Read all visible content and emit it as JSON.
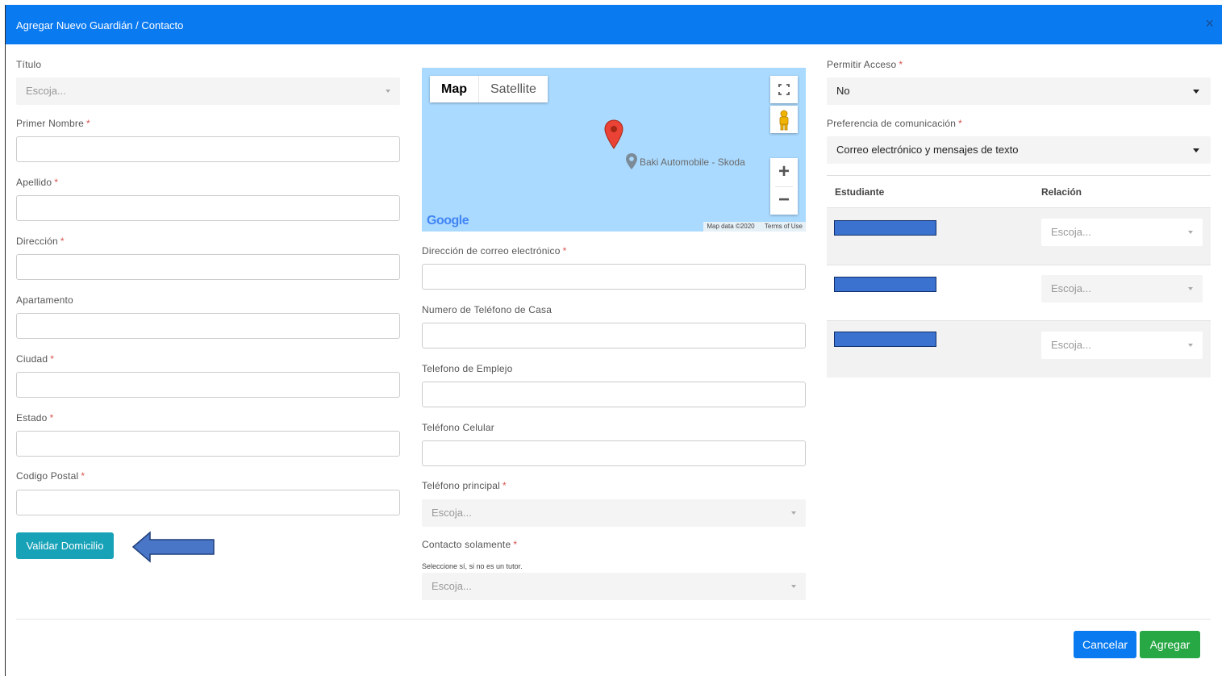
{
  "modal": {
    "title": "Agregar Nuevo Guardián / Contacto",
    "close_label": "×"
  },
  "left": {
    "titulo": {
      "label": "Título",
      "placeholder": "Escoja..."
    },
    "primer_nombre": {
      "label": "Primer Nombre",
      "value": ""
    },
    "apellido": {
      "label": "Apellido",
      "value": ""
    },
    "direccion": {
      "label": "Dirección",
      "value": ""
    },
    "apartamento": {
      "label": "Apartamento",
      "value": ""
    },
    "ciudad": {
      "label": "Ciudad",
      "value": ""
    },
    "estado": {
      "label": "Estado",
      "value": ""
    },
    "codigo_postal": {
      "label": "Codigo Postal",
      "value": ""
    },
    "validar_label": "Validar Domicilio"
  },
  "map": {
    "tab_map": "Map",
    "tab_satellite": "Satellite",
    "place_label": "Baki Automobile - Skoda",
    "attribution": "Map data ©2020",
    "terms": "Terms of Use",
    "brand": "Google",
    "zoom_in": "+",
    "zoom_out": "−"
  },
  "middle": {
    "email": {
      "label": "Dirección de correo electrónico",
      "value": ""
    },
    "tel_casa": {
      "label": "Numero de Teléfono de Casa",
      "value": ""
    },
    "tel_empleo": {
      "label": "Telefono de Emplejo",
      "value": ""
    },
    "tel_celular": {
      "label": "Teléfono Celular",
      "value": ""
    },
    "tel_principal": {
      "label": "Teléfono principal",
      "placeholder": "Escoja..."
    },
    "contacto_solamente": {
      "label": "Contacto solamente",
      "hint": "Seleccione sí, si no es un tutor.",
      "placeholder": "Escoja..."
    }
  },
  "right": {
    "permitir_acceso": {
      "label": "Permitir Acceso",
      "value": "No"
    },
    "preferencia": {
      "label": "Preferencia de comunicación",
      "value": "Correo electrónico y mensajes de texto"
    },
    "table": {
      "headers": [
        "Estudiante",
        "Relación"
      ],
      "rows": [
        {
          "relacion_placeholder": "Escoja..."
        },
        {
          "relacion_placeholder": "Escoja..."
        },
        {
          "relacion_placeholder": "Escoja..."
        }
      ]
    }
  },
  "footer": {
    "cancel_label": "Cancelar",
    "add_label": "Agregar"
  },
  "colors": {
    "header": "#0a7af0",
    "validate_button": "#17a2b8",
    "cancel_button": "#0a7af0",
    "add_button": "#28a745",
    "required": "#d9534f",
    "redacted_bar": "#3c72cf"
  }
}
